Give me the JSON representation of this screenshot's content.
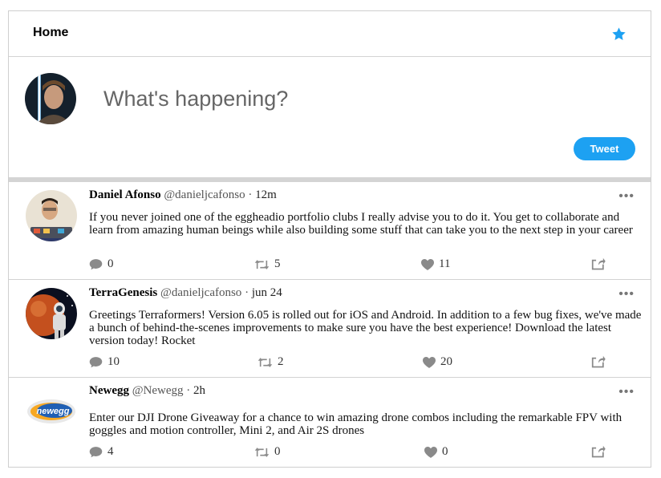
{
  "header": {
    "title": "Home"
  },
  "composer": {
    "placeholder": "What's happening?",
    "tweet_label": "Tweet"
  },
  "tweets": [
    {
      "author": "Daniel Afonso",
      "handle": "@danieljcafonso",
      "separator": "·",
      "time": "12m",
      "more": "•••",
      "text": "If you never joined one of the eggheadio portfolio clubs I really advise you to do it. You get to collaborate and learn from amazing human beings while also building some stuff that can take you to the next step in your career",
      "replies": "0",
      "retweets": "5",
      "likes": "11"
    },
    {
      "author": "TerraGenesis",
      "handle": "@danieljcafonso",
      "separator": "·",
      "time": "jun 24",
      "more": "•••",
      "text": "Greetings Terraformers! Version 6.05 is rolled out for iOS and Android. In addition to a few bug fixes, we've made a bunch of behind-the-scenes improvements to make sure you have the best experience! Download the latest version today! Rocket",
      "replies": "10",
      "retweets": "2",
      "likes": "20"
    },
    {
      "author": "Newegg",
      "handle": "@Newegg",
      "separator": "·",
      "time": "2h",
      "more": "•••",
      "text": "Enter our DJI Drone Giveaway for a chance to win amazing drone combos including the remarkable FPV with goggles and motion controller, Mini 2, and Air 2S drones",
      "replies": "4",
      "retweets": "0",
      "likes": "0",
      "logo_text": "newegg"
    }
  ],
  "colors": {
    "accent": "#1da1f2",
    "icon_gray": "#8a8a8a",
    "divider": "#d4d4d4"
  },
  "icons": {
    "star": "star-icon",
    "reply": "reply-icon",
    "retweet": "retweet-icon",
    "like": "heart-icon",
    "share": "share-icon",
    "more": "more-icon"
  }
}
